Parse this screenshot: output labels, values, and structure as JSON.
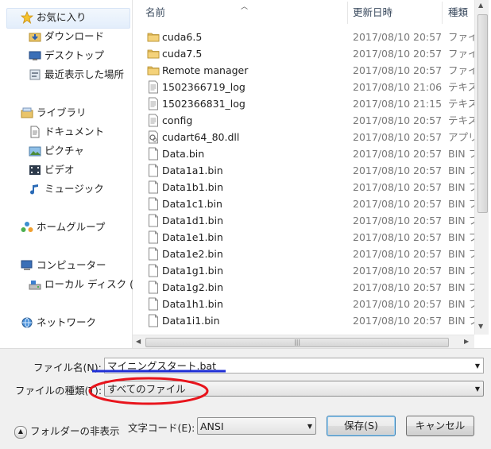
{
  "nav": {
    "favorites": "お気に入り",
    "downloads": "ダウンロード",
    "desktop": "デスクトップ",
    "recent": "最近表示した場所",
    "libraries": "ライブラリ",
    "documents": "ドキュメント",
    "pictures": "ピクチャ",
    "videos": "ビデオ",
    "music": "ミュージック",
    "homegroup": "ホームグループ",
    "computer": "コンピューター",
    "local_disk": "ローカル ディスク (",
    "network": "ネットワーク"
  },
  "columns": {
    "name": "名前",
    "date": "更新日時",
    "type": "種類"
  },
  "files": [
    {
      "name": "cuda6.5",
      "date": "2017/08/10 20:57",
      "type": "ファイ",
      "icon": "folder"
    },
    {
      "name": "cuda7.5",
      "date": "2017/08/10 20:57",
      "type": "ファイ",
      "icon": "folder"
    },
    {
      "name": "Remote manager",
      "date": "2017/08/10 20:57",
      "type": "ファイ",
      "icon": "folder"
    },
    {
      "name": "1502366719_log",
      "date": "2017/08/10 21:06",
      "type": "テキス",
      "icon": "text"
    },
    {
      "name": "1502366831_log",
      "date": "2017/08/10 21:15",
      "type": "テキス",
      "icon": "text"
    },
    {
      "name": "config",
      "date": "2017/08/10 20:57",
      "type": "テキス",
      "icon": "text"
    },
    {
      "name": "cudart64_80.dll",
      "date": "2017/08/10 20:57",
      "type": "アプリ",
      "icon": "dll"
    },
    {
      "name": "Data.bin",
      "date": "2017/08/10 20:57",
      "type": "BIN フ",
      "icon": "file"
    },
    {
      "name": "Data1a1.bin",
      "date": "2017/08/10 20:57",
      "type": "BIN フ",
      "icon": "file"
    },
    {
      "name": "Data1b1.bin",
      "date": "2017/08/10 20:57",
      "type": "BIN フ",
      "icon": "file"
    },
    {
      "name": "Data1c1.bin",
      "date": "2017/08/10 20:57",
      "type": "BIN フ",
      "icon": "file"
    },
    {
      "name": "Data1d1.bin",
      "date": "2017/08/10 20:57",
      "type": "BIN フ",
      "icon": "file"
    },
    {
      "name": "Data1e1.bin",
      "date": "2017/08/10 20:57",
      "type": "BIN フ",
      "icon": "file"
    },
    {
      "name": "Data1e2.bin",
      "date": "2017/08/10 20:57",
      "type": "BIN フ",
      "icon": "file"
    },
    {
      "name": "Data1g1.bin",
      "date": "2017/08/10 20:57",
      "type": "BIN フ",
      "icon": "file"
    },
    {
      "name": "Data1g2.bin",
      "date": "2017/08/10 20:57",
      "type": "BIN フ",
      "icon": "file"
    },
    {
      "name": "Data1h1.bin",
      "date": "2017/08/10 20:57",
      "type": "BIN フ",
      "icon": "file"
    },
    {
      "name": "Data1i1.bin",
      "date": "2017/08/10 20:57",
      "type": "BIN フ",
      "icon": "file"
    }
  ],
  "form": {
    "filename_label": "ファイル名(N):",
    "filename_value": "マイニングスタート.bat",
    "filetype_label": "ファイルの種類(T):",
    "filetype_value": "すべてのファイル",
    "hide_folders": "フォルダーの非表示",
    "encoding_label": "文字コード(E):",
    "encoding_value": "ANSI",
    "save": "保存(S)",
    "cancel": "キャンセル"
  },
  "colors": {
    "annotation_blue": "#1f2fd6",
    "annotation_red": "#e8141c",
    "folder": "#e9c46a",
    "accent": "#3c7fb1"
  }
}
